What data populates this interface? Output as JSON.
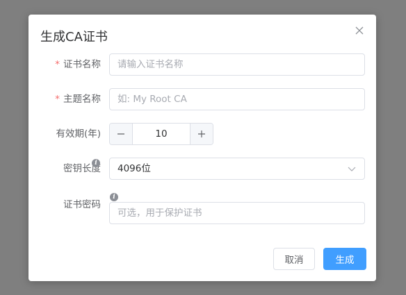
{
  "dialog": {
    "title": "生成CA证书",
    "close_icon": "close-icon"
  },
  "form": {
    "cert_name": {
      "label": "证书名称",
      "required_mark": "*",
      "placeholder": "请输入证书名称",
      "value": ""
    },
    "subject_name": {
      "label": "主题名称",
      "required_mark": "*",
      "placeholder": "如: My Root CA",
      "value": ""
    },
    "validity": {
      "label": "有效期(年)",
      "value": "10",
      "minus_icon": "minus-icon",
      "plus_icon": "plus-icon"
    },
    "key_length": {
      "label": "密钥长度",
      "info_icon": "info-icon",
      "info_glyph": "i",
      "selected": "4096位",
      "chevron_icon": "chevron-down-icon"
    },
    "cert_password": {
      "label": "证书密码",
      "info_icon": "info-icon",
      "info_glyph": "i",
      "placeholder": "可选，用于保护证书",
      "value": ""
    }
  },
  "footer": {
    "cancel_label": "取消",
    "submit_label": "生成"
  },
  "colors": {
    "overlay": "#7f7f7f",
    "primary": "#409eff",
    "required": "#f56c6c"
  }
}
